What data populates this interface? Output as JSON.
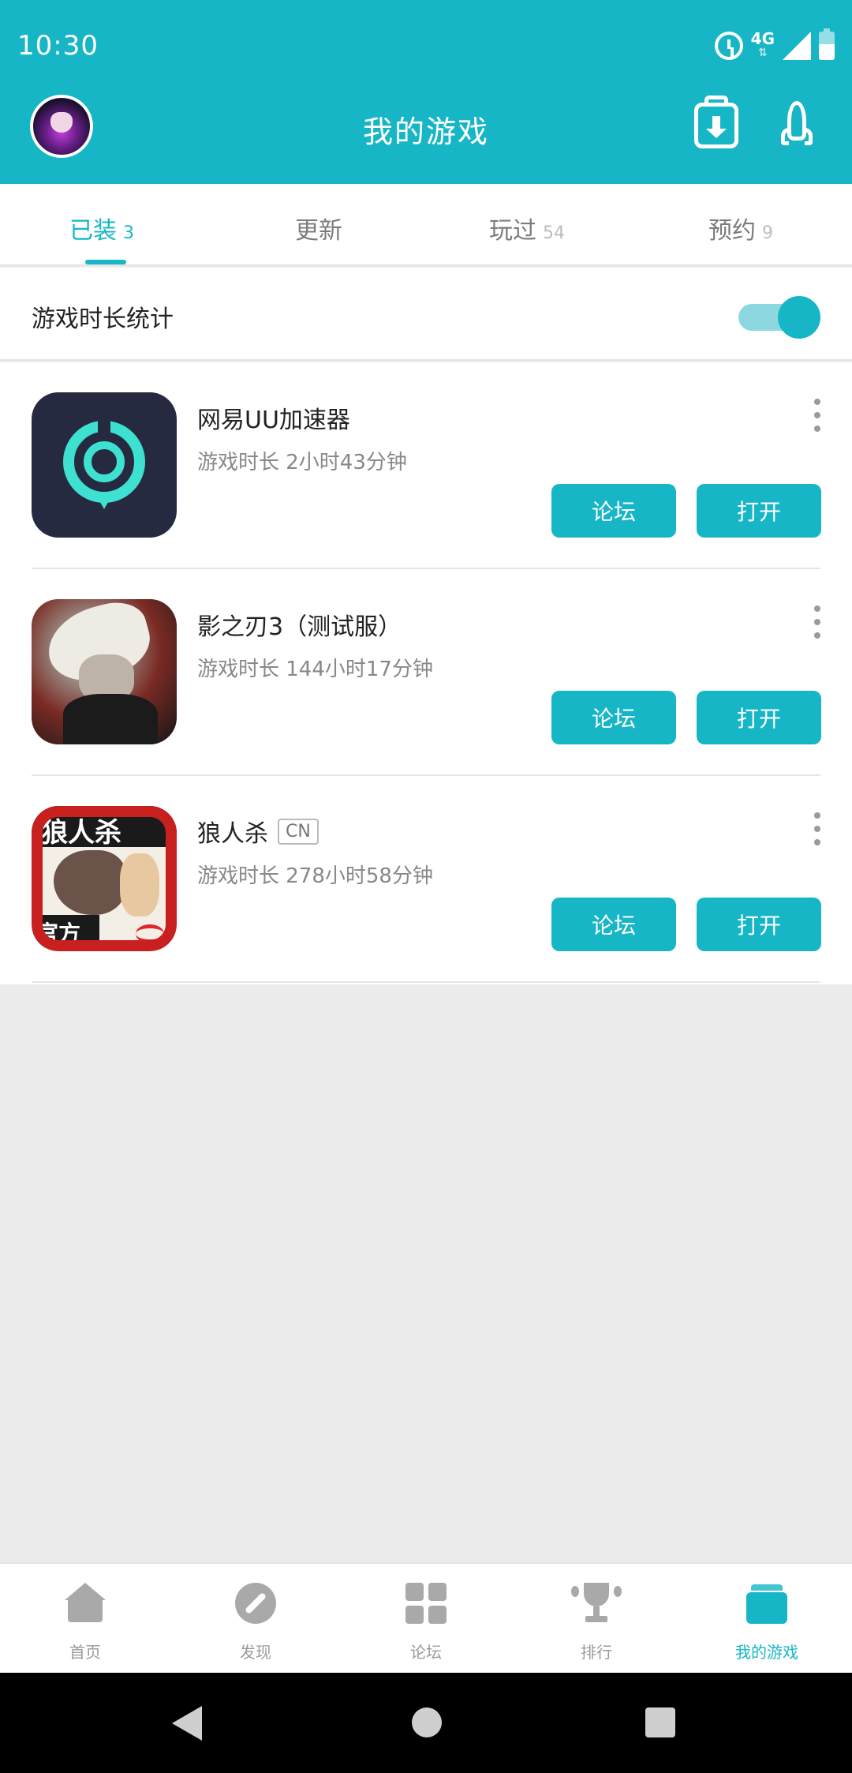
{
  "status_bar": {
    "time": "10:30",
    "network": "4G"
  },
  "header": {
    "title": "我的游戏",
    "avatar_icon": "user-avatar",
    "download_icon": "download-manager-icon",
    "rocket_icon": "rocket-icon"
  },
  "tabs": [
    {
      "label": "已装",
      "count": "3",
      "active": true
    },
    {
      "label": "更新",
      "count": "",
      "active": false
    },
    {
      "label": "玩过",
      "count": "54",
      "active": false
    },
    {
      "label": "预约",
      "count": "9",
      "active": false
    }
  ],
  "playtime_stats": {
    "label": "游戏时长统计",
    "enabled": true
  },
  "games": [
    {
      "name": "网易UU加速器",
      "region": "",
      "playtime": "游戏时长 2小时43分钟",
      "forum_label": "论坛",
      "open_label": "打开"
    },
    {
      "name": "影之刃3（测试服）",
      "region": "",
      "playtime": "游戏时长 144小时17分钟",
      "forum_label": "论坛",
      "open_label": "打开"
    },
    {
      "name": "狼人杀",
      "region": "CN",
      "playtime": "游戏时长 278小时58分钟",
      "forum_label": "论坛",
      "open_label": "打开"
    }
  ],
  "wolf_icon_text": {
    "top": "狼人杀",
    "badge": "官方"
  },
  "bottom_nav": [
    {
      "label": "首页",
      "icon": "home-icon",
      "active": false
    },
    {
      "label": "发现",
      "icon": "compass-icon",
      "active": false
    },
    {
      "label": "论坛",
      "icon": "grid-icon",
      "active": false
    },
    {
      "label": "排行",
      "icon": "trophy-icon",
      "active": false
    },
    {
      "label": "我的游戏",
      "icon": "stack-icon",
      "active": true
    }
  ],
  "colors": {
    "accent": "#17b6c6",
    "background": "#ececec"
  }
}
